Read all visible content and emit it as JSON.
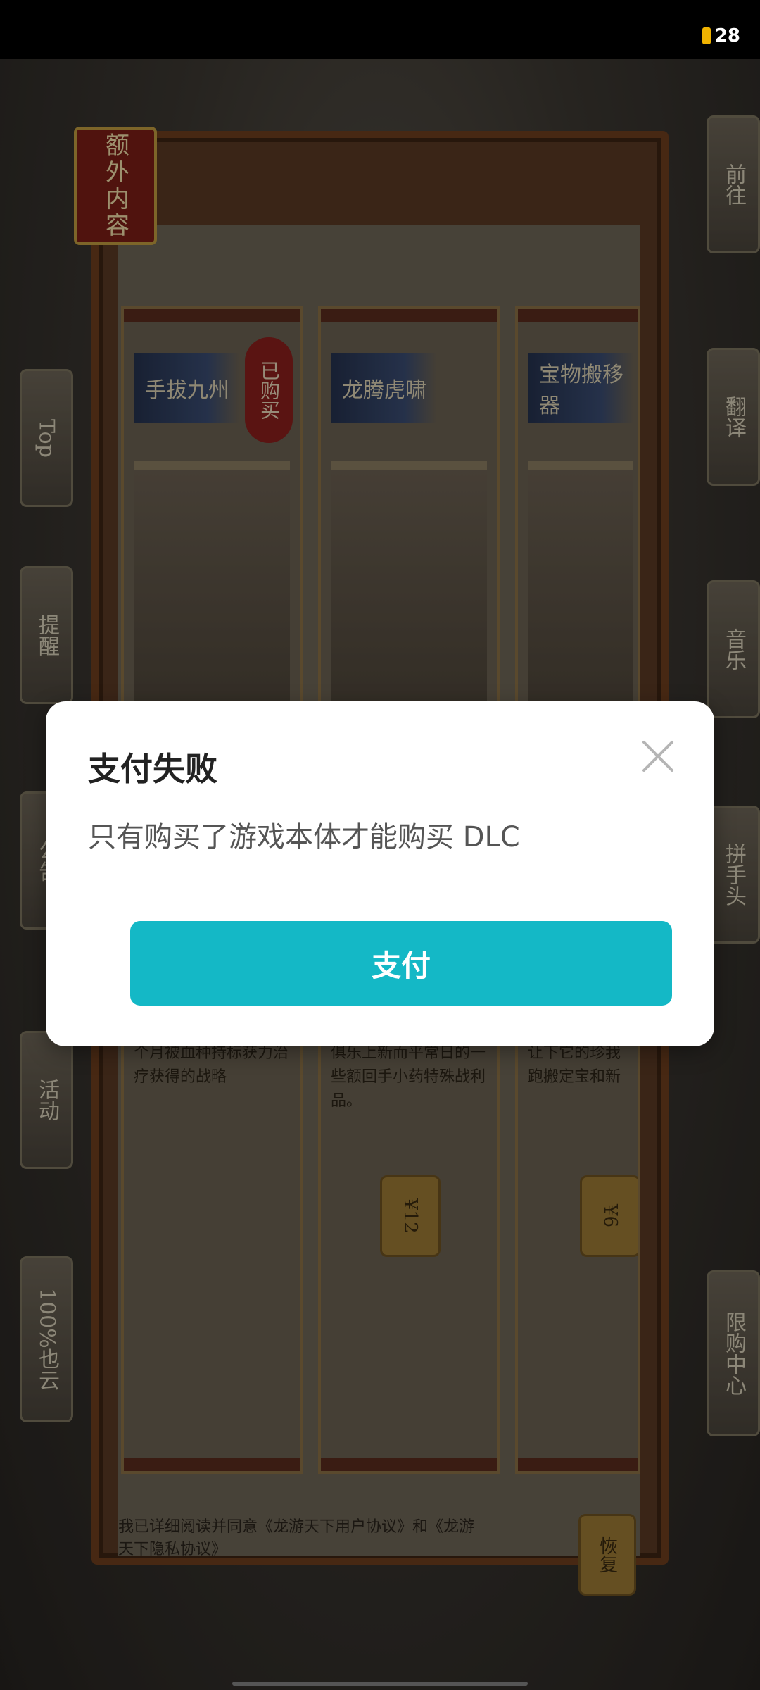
{
  "status_bar": {
    "battery_level": "28",
    "battery_color": "#f0b300"
  },
  "game": {
    "title": "额外内容",
    "side_buttons_left": [
      "Top",
      "提醒",
      "公告",
      "活动",
      "100%也云"
    ],
    "side_buttons_right": [
      "前往",
      "翻译",
      "音乐",
      "拼手头",
      "限购中心"
    ],
    "cards": [
      {
        "label": "手拔九州",
        "owned_stamp": "已购买",
        "description": "个月被血种持标获力治疗获得的战略",
        "price": ""
      },
      {
        "label": "龙腾虎啸",
        "owned_stamp": "",
        "description": "俱乐上新而平常日的一些额回手小药特殊战利品。",
        "price": "¥12"
      },
      {
        "label": "宝物搬移器",
        "owned_stamp": "",
        "description": "让下它的珍我跑搬定宝和新",
        "price": "¥6"
      }
    ],
    "agreement_text": "我已详细阅读并同意《龙游天下用户协议》和《龙游天下隐私协议》",
    "restore_label": "恢复"
  },
  "dialog": {
    "title": "支付失败",
    "message": "只有购买了游戏本体才能购买 DLC",
    "pay_button_label": "支付",
    "accent_color": "#14b8c6",
    "close_icon": "close-icon"
  }
}
